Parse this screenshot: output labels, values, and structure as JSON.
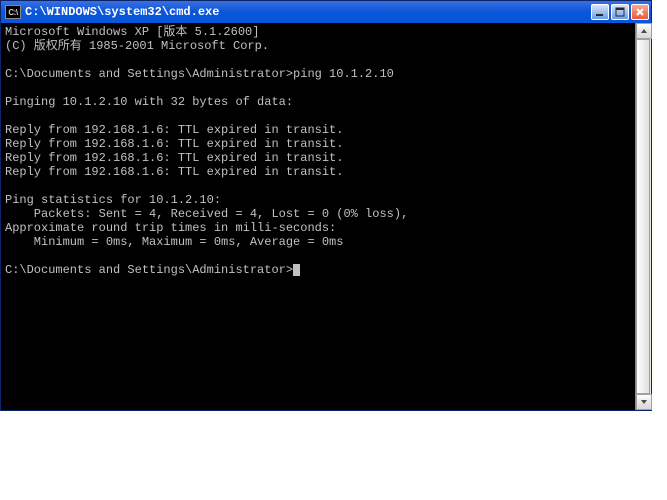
{
  "titlebar": {
    "icon_label": "C:\\",
    "title": "C:\\WINDOWS\\system32\\cmd.exe",
    "min_label": "minimize",
    "max_label": "maximize",
    "close_label": "close"
  },
  "terminal": {
    "lines": [
      "Microsoft Windows XP [版本 5.1.2600]",
      "(C) 版权所有 1985-2001 Microsoft Corp.",
      "",
      "C:\\Documents and Settings\\Administrator>ping 10.1.2.10",
      "",
      "Pinging 10.1.2.10 with 32 bytes of data:",
      "",
      "Reply from 192.168.1.6: TTL expired in transit.",
      "Reply from 192.168.1.6: TTL expired in transit.",
      "Reply from 192.168.1.6: TTL expired in transit.",
      "Reply from 192.168.1.6: TTL expired in transit.",
      "",
      "Ping statistics for 10.1.2.10:",
      "    Packets: Sent = 4, Received = 4, Lost = 0 (0% loss),",
      "Approximate round trip times in milli-seconds:",
      "    Minimum = 0ms, Maximum = 0ms, Average = 0ms",
      "",
      "C:\\Documents and Settings\\Administrator>"
    ],
    "cursor_after_last": true
  },
  "scrollbar": {
    "thumb_top_pct": 0,
    "thumb_height_pct": 100
  }
}
